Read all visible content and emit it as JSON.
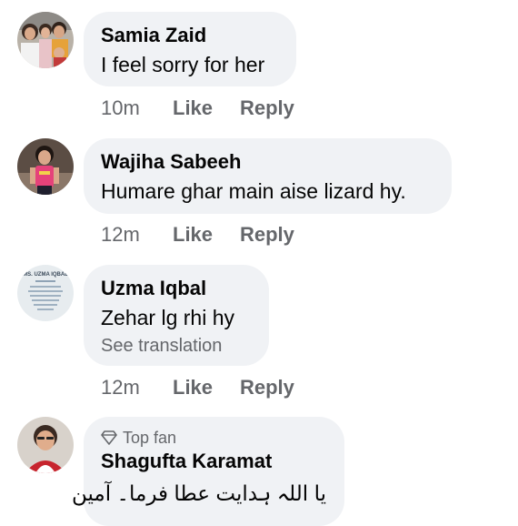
{
  "comments": [
    {
      "name": "Samia Zaid",
      "text": "I feel sorry for her",
      "time": "10m",
      "like_label": "Like",
      "reply_label": "Reply"
    },
    {
      "name": "Wajiha Sabeeh",
      "text": "Humare ghar main aise lizard hy.",
      "time": "12m",
      "like_label": "Like",
      "reply_label": "Reply"
    },
    {
      "name": "Uzma Iqbal",
      "text": "Zehar lg rhi hy",
      "see_translation": "See translation",
      "avatar_text": "MS. UZMA IQBAL",
      "time": "12m",
      "like_label": "Like",
      "reply_label": "Reply"
    },
    {
      "badge": "Top fan",
      "name": "Shagufta Karamat",
      "text": "یا اللہ ہدایت عطا فرما۔ آمین"
    }
  ],
  "colors": {
    "bubble": "#f0f2f5",
    "secondary_text": "#65676b",
    "primary_text": "#050505"
  }
}
